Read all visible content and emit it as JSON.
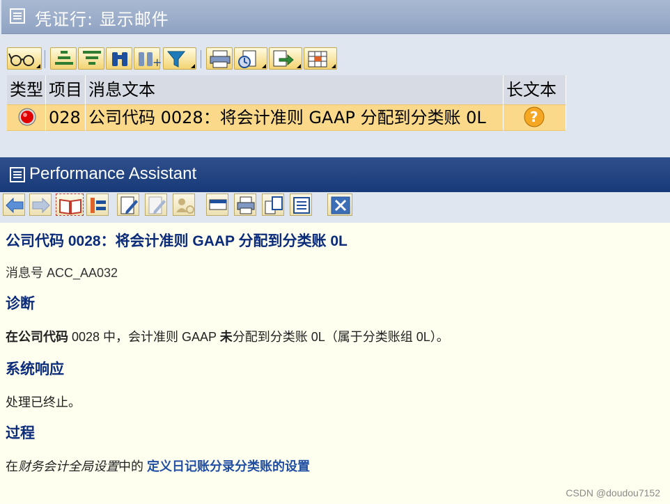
{
  "window1": {
    "title": "凭证行: 显示邮件",
    "toolbar": [
      {
        "icon": "glasses-detail-icon",
        "has_dropdown": true
      },
      {
        "icon": "sort-ascending-icon",
        "has_dropdown": false
      },
      {
        "icon": "sort-descending-icon",
        "has_dropdown": false
      },
      {
        "icon": "find-binoculars-icon",
        "has_dropdown": false
      },
      {
        "icon": "find-next-icon",
        "has_dropdown": false
      },
      {
        "icon": "filter-icon",
        "has_dropdown": true
      },
      {
        "icon": "print-icon",
        "has_dropdown": false
      },
      {
        "icon": "views-icon",
        "has_dropdown": true
      },
      {
        "icon": "export-icon",
        "has_dropdown": true
      },
      {
        "icon": "layout-icon",
        "has_dropdown": true
      }
    ],
    "grid": {
      "headers": [
        "类型",
        "项目",
        "消息文本",
        "长文本"
      ],
      "rows": [
        {
          "type_icon": "error-red-light-icon",
          "item": "028",
          "message": "公司代码 0028：将会计准则 GAAP 分配到分类账 0L",
          "longtext_icon": "help-question-icon"
        }
      ]
    }
  },
  "window2": {
    "title": "Performance Assistant",
    "toolbar": [
      {
        "icon": "back-arrow-icon"
      },
      {
        "icon": "forward-arrow-icon"
      },
      {
        "icon": "open-book-icon",
        "active": true
      },
      {
        "icon": "tools-icon"
      },
      {
        "icon": "edit-pencil-icon"
      },
      {
        "icon": "edit-pencil-disabled-icon"
      },
      {
        "icon": "user-settings-icon"
      },
      {
        "icon": "document-icon"
      },
      {
        "icon": "print-icon"
      },
      {
        "icon": "copy-icon"
      },
      {
        "icon": "notes-icon"
      },
      {
        "icon": "close-x-icon"
      }
    ],
    "content": {
      "heading": "公司代码 0028：将会计准则 GAAP 分配到分类账 0L",
      "message_no": "消息号 ACC_AA032",
      "diag_title": "诊断",
      "diag_bold1": "在公司代码",
      "diag_text1": " 0028 中，会计准则 GAAP ",
      "diag_bold2": "未",
      "diag_text2": "分配到分类账 0L（属于分类账组 0L）。",
      "sys_title": "系统响应",
      "sys_text": "处理已终止。",
      "proc_title": "过程",
      "proc_prefix": "在",
      "proc_italic": "财务会计全局设置",
      "proc_mid": "中的 ",
      "proc_link": "定义日记账分录分类账的设置"
    },
    "watermark": "CSDN @doudou7152"
  }
}
